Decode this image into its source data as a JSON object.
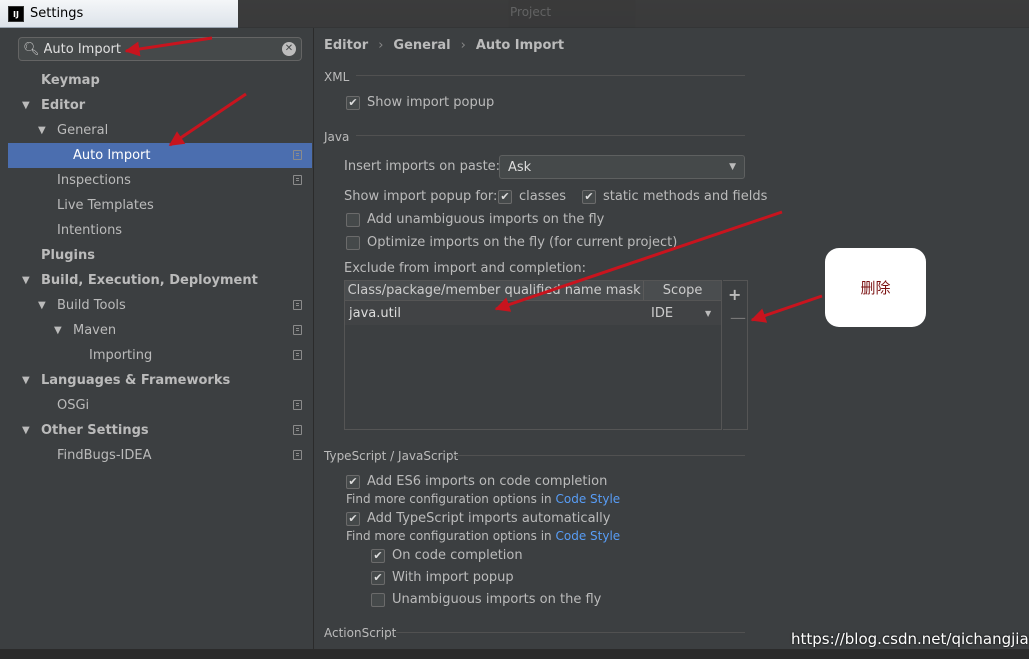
{
  "window": {
    "title": "Settings",
    "logo": "IJ",
    "bg_project": "Project"
  },
  "search": {
    "value": "Auto Import"
  },
  "tree": [
    {
      "label": "Keymap",
      "arrow": "",
      "indent": 0,
      "bold": true,
      "icon": false,
      "selected": false
    },
    {
      "label": "Editor",
      "arrow": "▼",
      "indent": 0,
      "bold": true,
      "icon": false,
      "selected": false
    },
    {
      "label": "General",
      "arrow": "▼",
      "indent": 1,
      "bold": false,
      "icon": false,
      "selected": false
    },
    {
      "label": "Auto Import",
      "arrow": "",
      "indent": 2,
      "bold": false,
      "icon": true,
      "selected": true
    },
    {
      "label": "Inspections",
      "arrow": "",
      "indent": 1,
      "bold": false,
      "icon": true,
      "selected": false
    },
    {
      "label": "Live Templates",
      "arrow": "",
      "indent": 1,
      "bold": false,
      "icon": false,
      "selected": false
    },
    {
      "label": "Intentions",
      "arrow": "",
      "indent": 1,
      "bold": false,
      "icon": false,
      "selected": false
    },
    {
      "label": "Plugins",
      "arrow": "",
      "indent": 0,
      "bold": true,
      "icon": false,
      "selected": false
    },
    {
      "label": "Build, Execution, Deployment",
      "arrow": "▼",
      "indent": 0,
      "bold": true,
      "icon": false,
      "selected": false
    },
    {
      "label": "Build Tools",
      "arrow": "▼",
      "indent": 1,
      "bold": false,
      "icon": true,
      "selected": false
    },
    {
      "label": "Maven",
      "arrow": "▼",
      "indent": 2,
      "bold": false,
      "icon": true,
      "selected": false
    },
    {
      "label": "Importing",
      "arrow": "",
      "indent": 3,
      "bold": false,
      "icon": true,
      "selected": false
    },
    {
      "label": "Languages & Frameworks",
      "arrow": "▼",
      "indent": 0,
      "bold": true,
      "icon": false,
      "selected": false
    },
    {
      "label": "OSGi",
      "arrow": "",
      "indent": 1,
      "bold": false,
      "icon": true,
      "selected": false
    },
    {
      "label": "Other Settings",
      "arrow": "▼",
      "indent": 0,
      "bold": true,
      "icon": true,
      "selected": false
    },
    {
      "label": "FindBugs-IDEA",
      "arrow": "",
      "indent": 1,
      "bold": false,
      "icon": true,
      "selected": false
    }
  ],
  "breadcrumb": [
    "Editor",
    "General",
    "Auto Import"
  ],
  "breadcrumb_sep": "›",
  "sections": {
    "xml": "XML",
    "java": "Java",
    "ts": "TypeScript / JavaScript",
    "as": "ActionScript"
  },
  "xml": {
    "show_import_popup": {
      "label": "Show import popup",
      "checked": true
    }
  },
  "java": {
    "insert_label": "Insert imports on paste:",
    "insert_value": "Ask",
    "popup_for_label": "Show import popup for:",
    "classes": {
      "label": "classes",
      "checked": true
    },
    "static": {
      "label": "static methods and fields",
      "checked": true
    },
    "unambiguous": {
      "label": "Add unambiguous imports on the fly",
      "checked": false
    },
    "optimize": {
      "label": "Optimize imports on the fly (for current project)",
      "checked": false
    },
    "exclude_label": "Exclude from import and completion:",
    "table": {
      "columns": [
        "Class/package/member qualified name mask",
        "Scope"
      ],
      "rows": [
        {
          "name": "java.util",
          "scope": "IDE"
        }
      ]
    }
  },
  "ts": {
    "es6": {
      "label": "Add ES6 imports on code completion",
      "checked": true
    },
    "find_more_1": "Find more configuration options in",
    "link_1": "Code Style",
    "ts_auto": {
      "label": "Add TypeScript imports automatically",
      "checked": true
    },
    "find_more_2": "Find more configuration options in",
    "link_2": "Code Style",
    "on_completion": {
      "label": "On code completion",
      "checked": true
    },
    "with_popup": {
      "label": "With import popup",
      "checked": true
    },
    "unambiguous": {
      "label": "Unambiguous imports on the fly",
      "checked": false
    }
  },
  "annotation": {
    "bubble_text": "删除",
    "arrow_color": "#c8141e"
  },
  "watermark": "https://blog.csdn.net/qichangjian"
}
